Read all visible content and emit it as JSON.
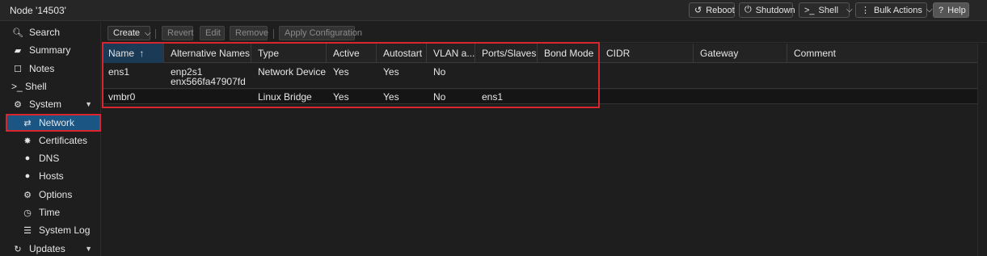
{
  "window": {
    "title": "Node '14503'"
  },
  "top_actions": {
    "reboot": "Reboot",
    "shutdown": "Shutdown",
    "shell": "Shell",
    "bulk_actions": "Bulk Actions",
    "help": "Help"
  },
  "sidebar": {
    "items": [
      {
        "label": "Search",
        "icon": "search-icon"
      },
      {
        "label": "Summary",
        "icon": "book-icon"
      },
      {
        "label": "Notes",
        "icon": "note-icon"
      },
      {
        "label": ">_ Shell",
        "icon": "terminal-icon"
      },
      {
        "label": "System",
        "icon": "cogs-icon",
        "expanded": true
      },
      {
        "label": "Network",
        "icon": "exchange-icon",
        "selected": true
      },
      {
        "label": "Certificates",
        "icon": "certificate-icon"
      },
      {
        "label": "DNS",
        "icon": "globe-icon"
      },
      {
        "label": "Hosts",
        "icon": "globe-icon"
      },
      {
        "label": "Options",
        "icon": "gear-icon"
      },
      {
        "label": "Time",
        "icon": "clock-icon"
      },
      {
        "label": "System Log",
        "icon": "list-icon"
      },
      {
        "label": "Updates",
        "icon": "refresh-icon",
        "expanded": true
      }
    ]
  },
  "toolbar": {
    "create": "Create",
    "revert": "Revert",
    "edit": "Edit",
    "remove": "Remove",
    "apply_configuration": "Apply Configuration"
  },
  "grid": {
    "columns": [
      "Name",
      "Alternative Names",
      "Type",
      "Active",
      "Autostart",
      "VLAN a...",
      "Ports/Slaves",
      "Bond Mode",
      "CIDR",
      "Gateway",
      "Comment"
    ],
    "sort": {
      "column": "Name",
      "direction": "ascending"
    },
    "rows": [
      {
        "name": "ens1",
        "alt_names": [
          "enp2s1",
          "enx566fa47907fd"
        ],
        "type": "Network Device",
        "active": "Yes",
        "autostart": "Yes",
        "vlan": "No",
        "ports": "",
        "bond_mode": "",
        "cidr": "",
        "gateway": "",
        "comment": ""
      },
      {
        "name": "vmbr0",
        "alt_names": [],
        "type": "Linux Bridge",
        "active": "Yes",
        "autostart": "Yes",
        "vlan": "No",
        "ports": "ens1",
        "bond_mode": "",
        "cidr": "",
        "gateway": "",
        "comment": ""
      }
    ]
  },
  "colors": {
    "background": "#1e1e1e",
    "selected_nav": "#1b5584",
    "highlight_border": "#d8262f",
    "sorted_header": "#1b3a56"
  }
}
